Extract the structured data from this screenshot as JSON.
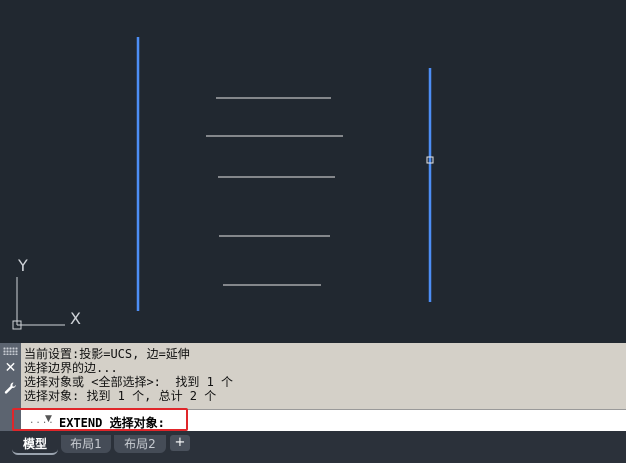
{
  "colors": {
    "canvas_bg": "#212830",
    "boundary_line": "#4d8ef5",
    "white_line": "#e6e6e6",
    "highlight": "#e0262a"
  },
  "ucs": {
    "y_label": "Y",
    "x_label": "X"
  },
  "command_history": {
    "lines": [
      "当前设置:投影=UCS, 边=延伸",
      "选择边界的边...",
      "选择对象或 <全部选择>:  找到 1 个",
      "选择对象: 找到 1 个, 总计 2 个"
    ]
  },
  "command_input": {
    "dots": "....",
    "prompt": "EXTEND 选择对象:"
  },
  "tabs": [
    {
      "label": "模型",
      "active": true
    },
    {
      "label": "布局1",
      "active": false
    },
    {
      "label": "布局2",
      "active": false
    }
  ],
  "tab_add_label": "+",
  "icons": {
    "close": "close-icon",
    "settings": "wrench-icon",
    "grip": "grip-icon"
  }
}
